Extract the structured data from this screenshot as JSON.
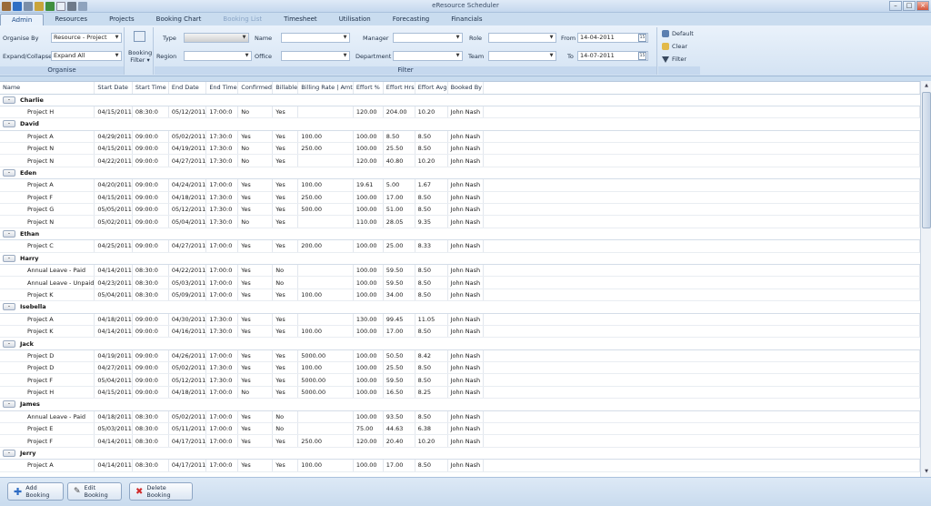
{
  "window": {
    "title": "eResource Scheduler"
  },
  "tabs": [
    {
      "label": "Admin"
    },
    {
      "label": "Resources"
    },
    {
      "label": "Projects"
    },
    {
      "label": "Booking Chart"
    },
    {
      "label": "Booking List"
    },
    {
      "label": "Timesheet"
    },
    {
      "label": "Utilisation"
    },
    {
      "label": "Forecasting"
    },
    {
      "label": "Financials"
    }
  ],
  "organise": {
    "organise_by_label": "Organise By",
    "organise_by_value": "Resource - Project",
    "expand_label": "Expand/Collapse",
    "expand_value": "Expand All",
    "group_label": "Organise"
  },
  "booking_filter": {
    "label": "Booking Filter",
    "arrow": "▾"
  },
  "filter": {
    "type_label": "Type",
    "name_label": "Name",
    "manager_label": "Manager",
    "role_label": "Role",
    "from_label": "From",
    "from_value": "14-04-2011",
    "region_label": "Region",
    "office_label": "Office",
    "department_label": "Department",
    "team_label": "Team",
    "to_label": "To",
    "to_value": "14-07-2011",
    "cal_text": "15",
    "group_label": "Filter"
  },
  "filter_actions": {
    "default_label": "Default",
    "clear_label": "Clear",
    "filter_label": "Filter"
  },
  "table": {
    "headers": [
      "Name",
      "Start Date",
      "Start Time",
      "End Date",
      "End Time",
      "Confirmed",
      "Billable",
      "Billing Rate | Amt",
      "Effort %",
      "Effort Hrs",
      "Effort Avg",
      "Booked By"
    ],
    "groups": [
      {
        "name": "Charlie",
        "toggle": "-",
        "rows": [
          [
            "Project H",
            "04/15/2011",
            "08:30:0",
            "05/12/2011",
            "17:00:0",
            "No",
            "Yes",
            "",
            "120.00",
            "204.00",
            "10.20",
            "John Nash"
          ]
        ]
      },
      {
        "name": "David",
        "toggle": "-",
        "rows": [
          [
            "Project A",
            "04/29/2011",
            "09:00:0",
            "05/02/2011",
            "17:30:0",
            "Yes",
            "Yes",
            "100.00",
            "100.00",
            "8.50",
            "8.50",
            "John Nash"
          ],
          [
            "Project N",
            "04/15/2011",
            "09:00:0",
            "04/19/2011",
            "17:30:0",
            "No",
            "Yes",
            "250.00",
            "100.00",
            "25.50",
            "8.50",
            "John Nash"
          ],
          [
            "Project N",
            "04/22/2011",
            "09:00:0",
            "04/27/2011",
            "17:30:0",
            "No",
            "Yes",
            "",
            "120.00",
            "40.80",
            "10.20",
            "John Nash"
          ]
        ]
      },
      {
        "name": "Eden",
        "toggle": "-",
        "rows": [
          [
            "Project A",
            "04/20/2011",
            "09:00:0",
            "04/24/2011",
            "17:00:0",
            "Yes",
            "Yes",
            "100.00",
            "19.61",
            "5.00",
            "1.67",
            "John Nash"
          ],
          [
            "Project F",
            "04/15/2011",
            "09:00:0",
            "04/18/2011",
            "17:30:0",
            "Yes",
            "Yes",
            "250.00",
            "100.00",
            "17.00",
            "8.50",
            "John Nash"
          ],
          [
            "Project G",
            "05/05/2011",
            "09:00:0",
            "05/12/2011",
            "17:30:0",
            "Yes",
            "Yes",
            "500.00",
            "100.00",
            "51.00",
            "8.50",
            "John Nash"
          ],
          [
            "Project N",
            "05/02/2011",
            "09:00:0",
            "05/04/2011",
            "17:30:0",
            "No",
            "Yes",
            "",
            "110.00",
            "28.05",
            "9.35",
            "John Nash"
          ]
        ]
      },
      {
        "name": "Ethan",
        "toggle": "-",
        "rows": [
          [
            "Project C",
            "04/25/2011",
            "09:00:0",
            "04/27/2011",
            "17:00:0",
            "Yes",
            "Yes",
            "200.00",
            "100.00",
            "25.00",
            "8.33",
            "John Nash"
          ]
        ]
      },
      {
        "name": "Harry",
        "toggle": "-",
        "rows": [
          [
            "Annual Leave - Paid",
            "04/14/2011",
            "08:30:0",
            "04/22/2011",
            "17:00:0",
            "Yes",
            "No",
            "",
            "100.00",
            "59.50",
            "8.50",
            "John Nash"
          ],
          [
            "Annual Leave - Unpaid",
            "04/23/2011",
            "08:30:0",
            "05/03/2011",
            "17:00:0",
            "Yes",
            "No",
            "",
            "100.00",
            "59.50",
            "8.50",
            "John Nash"
          ],
          [
            "Project K",
            "05/04/2011",
            "08:30:0",
            "05/09/2011",
            "17:00:0",
            "Yes",
            "Yes",
            "100.00",
            "100.00",
            "34.00",
            "8.50",
            "John Nash"
          ]
        ]
      },
      {
        "name": "Isebella",
        "toggle": "-",
        "rows": [
          [
            "Project A",
            "04/18/2011",
            "09:00:0",
            "04/30/2011",
            "17:30:0",
            "Yes",
            "Yes",
            "",
            "130.00",
            "99.45",
            "11.05",
            "John Nash"
          ],
          [
            "Project K",
            "04/14/2011",
            "09:00:0",
            "04/16/2011",
            "17:30:0",
            "Yes",
            "Yes",
            "100.00",
            "100.00",
            "17.00",
            "8.50",
            "John Nash"
          ]
        ]
      },
      {
        "name": "Jack",
        "toggle": "-",
        "rows": [
          [
            "Project D",
            "04/19/2011",
            "09:00:0",
            "04/26/2011",
            "17:00:0",
            "Yes",
            "Yes",
            "5000.00",
            "100.00",
            "50.50",
            "8.42",
            "John Nash"
          ],
          [
            "Project D",
            "04/27/2011",
            "09:00:0",
            "05/02/2011",
            "17:30:0",
            "Yes",
            "Yes",
            "100.00",
            "100.00",
            "25.50",
            "8.50",
            "John Nash"
          ],
          [
            "Project F",
            "05/04/2011",
            "09:00:0",
            "05/12/2011",
            "17:30:0",
            "Yes",
            "Yes",
            "5000.00",
            "100.00",
            "59.50",
            "8.50",
            "John Nash"
          ],
          [
            "Project H",
            "04/15/2011",
            "09:00:0",
            "04/18/2011",
            "17:00:0",
            "No",
            "Yes",
            "5000.00",
            "100.00",
            "16.50",
            "8.25",
            "John Nash"
          ]
        ]
      },
      {
        "name": "James",
        "toggle": "-",
        "rows": [
          [
            "Annual Leave - Paid",
            "04/18/2011",
            "08:30:0",
            "05/02/2011",
            "17:00:0",
            "Yes",
            "No",
            "",
            "100.00",
            "93.50",
            "8.50",
            "John Nash"
          ],
          [
            "Project E",
            "05/03/2011",
            "08:30:0",
            "05/11/2011",
            "17:00:0",
            "Yes",
            "No",
            "",
            "75.00",
            "44.63",
            "6.38",
            "John Nash"
          ],
          [
            "Project F",
            "04/14/2011",
            "08:30:0",
            "04/17/2011",
            "17:00:0",
            "Yes",
            "Yes",
            "250.00",
            "120.00",
            "20.40",
            "10.20",
            "John Nash"
          ]
        ]
      },
      {
        "name": "Jerry",
        "toggle": "-",
        "rows": [
          [
            "Project A",
            "04/14/2011",
            "08:30:0",
            "04/17/2011",
            "17:00:0",
            "Yes",
            "Yes",
            "100.00",
            "100.00",
            "17.00",
            "8.50",
            "John Nash"
          ]
        ]
      }
    ]
  },
  "bottom": {
    "add_label": "Add Booking",
    "edit_label": "Edit Booking",
    "delete_label": "Delete Booking"
  },
  "colors": {
    "accent": "#1d4a86",
    "ribbon": "#d4e3f3",
    "frame": "#c9dcef"
  }
}
